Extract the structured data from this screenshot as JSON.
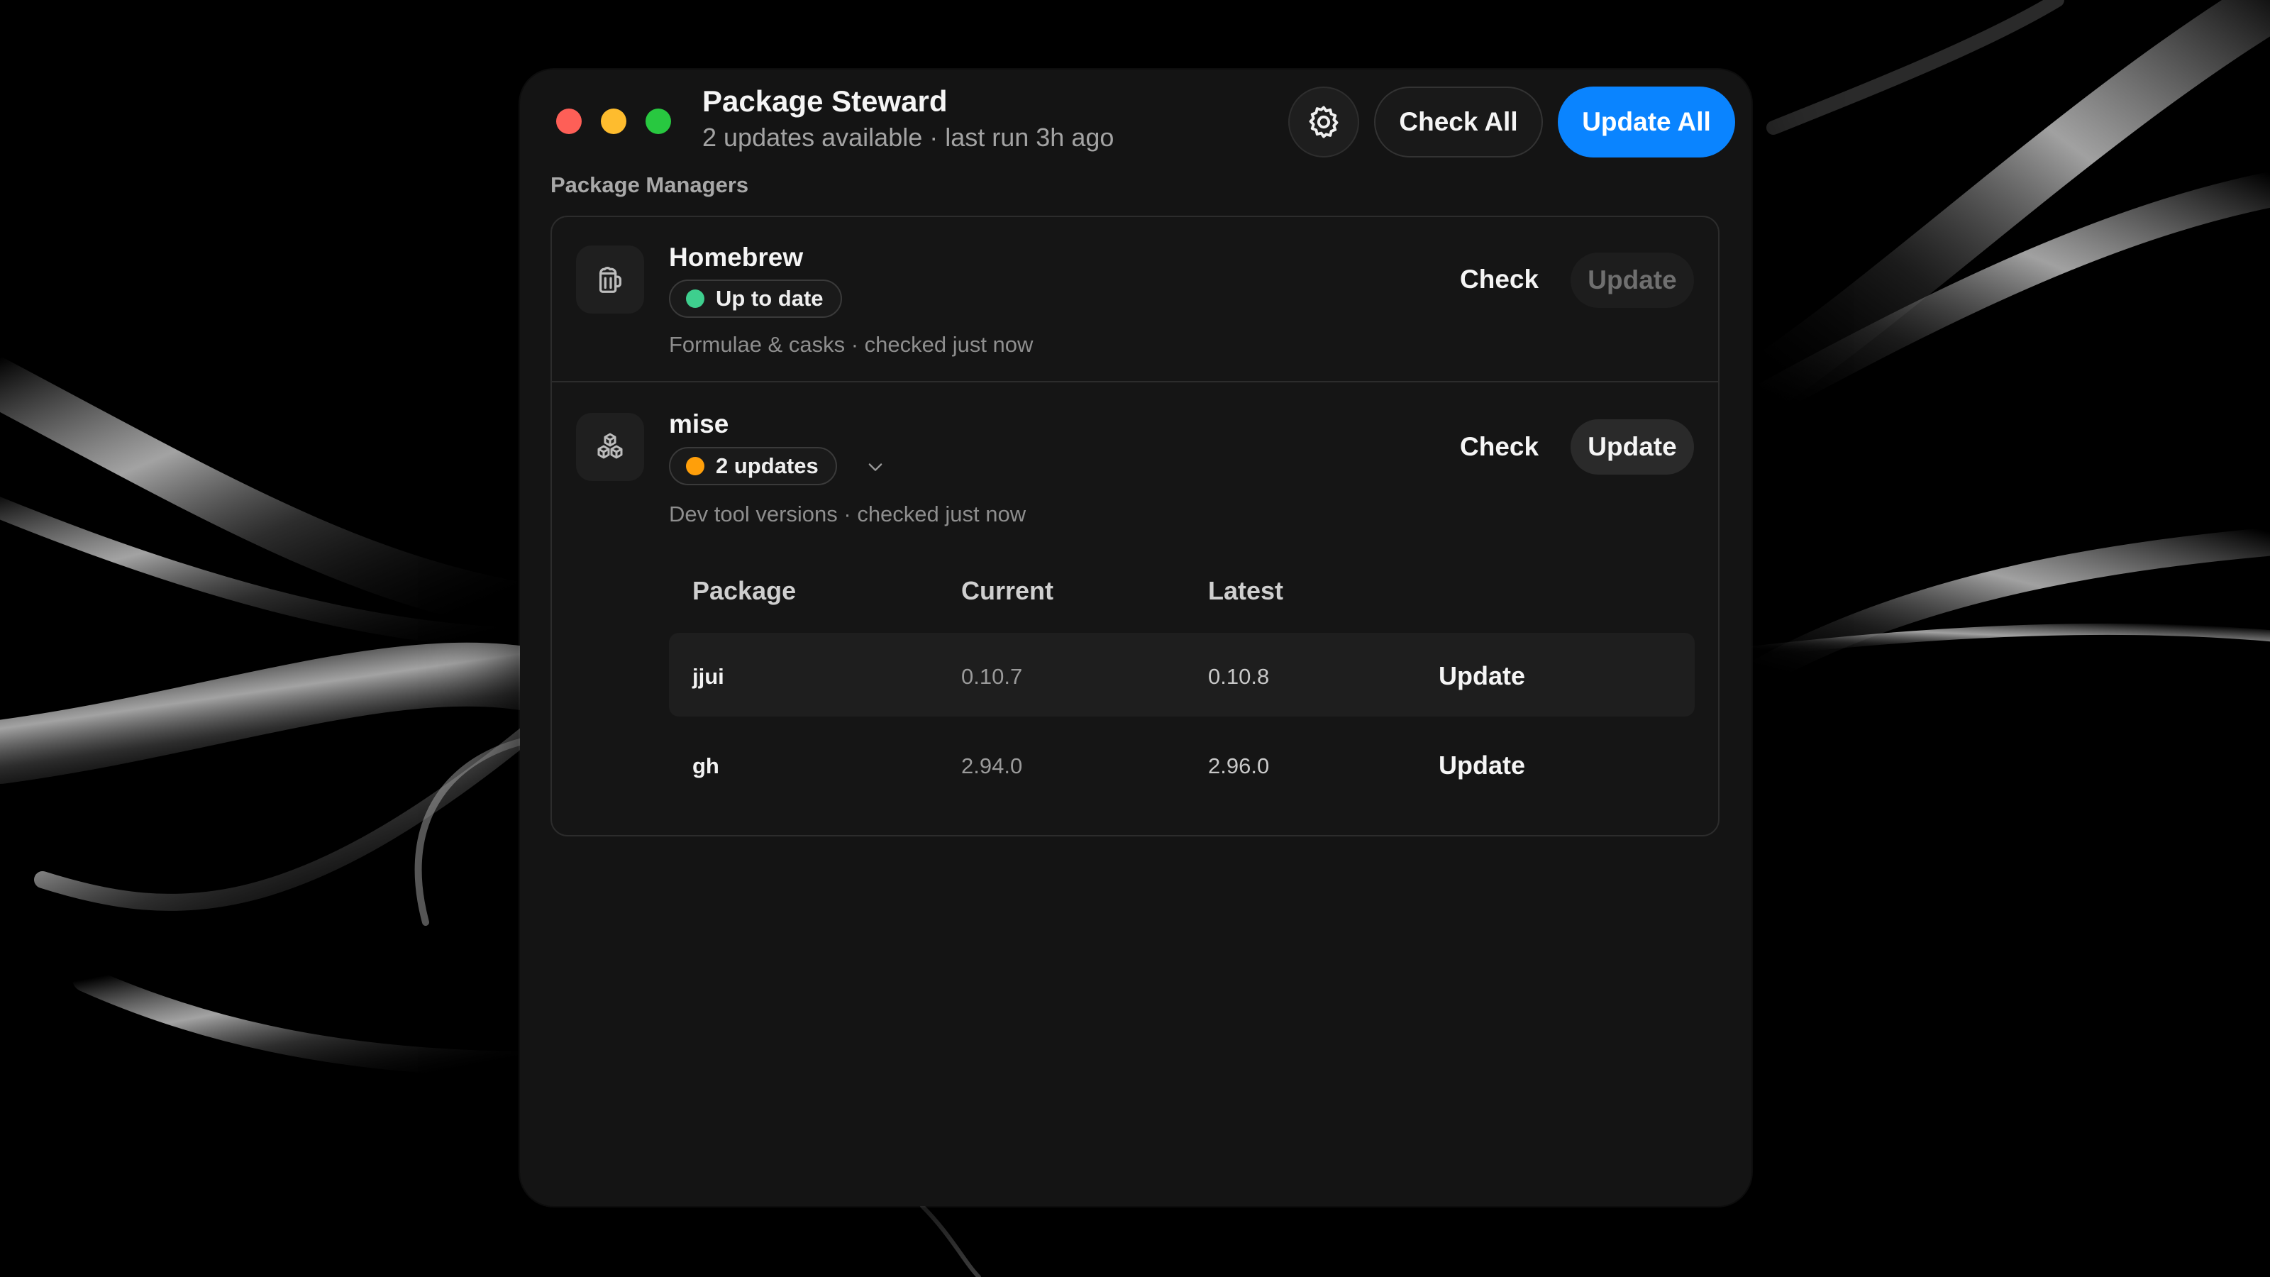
{
  "app": {
    "title": "Package Steward",
    "subtitle": "2 updates available · last run 3h ago"
  },
  "toolbar": {
    "settings_icon": "gear-icon",
    "check_all_label": "Check All",
    "update_all_label": "Update All",
    "accent_color": "#0a84ff"
  },
  "section": {
    "label": "Package Managers"
  },
  "managers": [
    {
      "name": "Homebrew",
      "icon": "beer-mug-icon",
      "status": "Up to date",
      "status_color": "#3ecf8e",
      "description": "Formulae & casks · checked just now",
      "check_label": "Check",
      "update_label": "Update",
      "update_enabled": false
    },
    {
      "name": "mise",
      "icon": "cubes-icon",
      "status": "2 updates",
      "status_color": "#ff9f0a",
      "description": "Dev tool versions · checked just now",
      "check_label": "Check",
      "update_label": "Update",
      "update_enabled": true,
      "expanded": true,
      "table": {
        "headers": [
          "Package",
          "Current",
          "Latest"
        ],
        "rows": [
          {
            "package": "jjui",
            "current": "0.10.7",
            "latest": "0.10.8",
            "action": "Update"
          },
          {
            "package": "gh",
            "current": "2.94.0",
            "latest": "2.96.0",
            "action": "Update"
          }
        ]
      }
    }
  ]
}
